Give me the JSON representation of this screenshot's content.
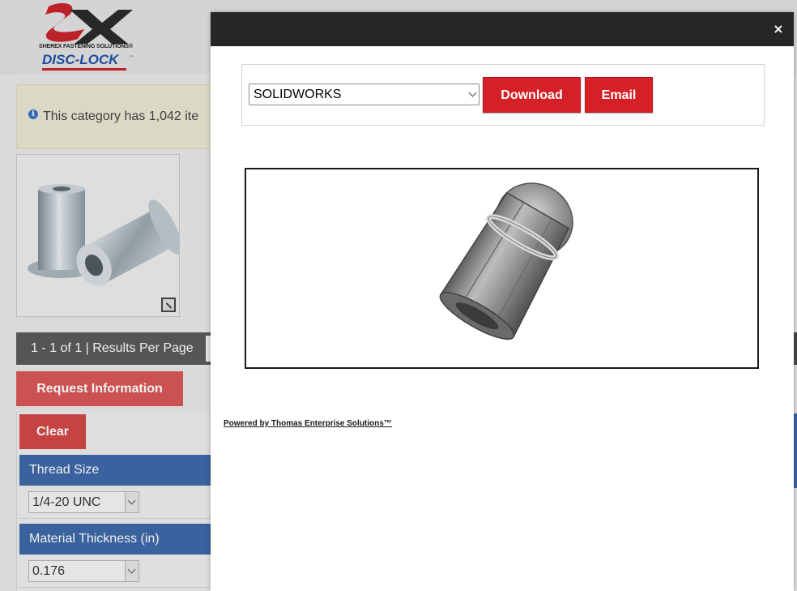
{
  "header": {
    "logo_tagline": "SHEREX FASTENING SOLUTIONS®",
    "logo_brand": "DISC-LOCK",
    "logo_tm": "™",
    "logo_icon": "sherex-x-logo"
  },
  "category": {
    "info_text": "This category has 1,042 ite"
  },
  "results": {
    "summary": "1 - 1 of 1  |  Results Per Page"
  },
  "actions": {
    "request_info_label": "Request Information",
    "clear_label": "Clear"
  },
  "filters": [
    {
      "label": "Thread Size",
      "selected": "1/4-20 UNC"
    },
    {
      "label": "Material Thickness (in)",
      "selected": "0.176"
    }
  ],
  "modal": {
    "close_label": "×",
    "format_selected": "SOLIDWORKS",
    "download_label": "Download",
    "email_label": "Email",
    "powered_by": "Powered by Thomas Enterprise Solutions™"
  },
  "colors": {
    "brand_red": "#d62027",
    "filter_blue": "#3d69a8",
    "titlebar_dark": "#262626"
  }
}
